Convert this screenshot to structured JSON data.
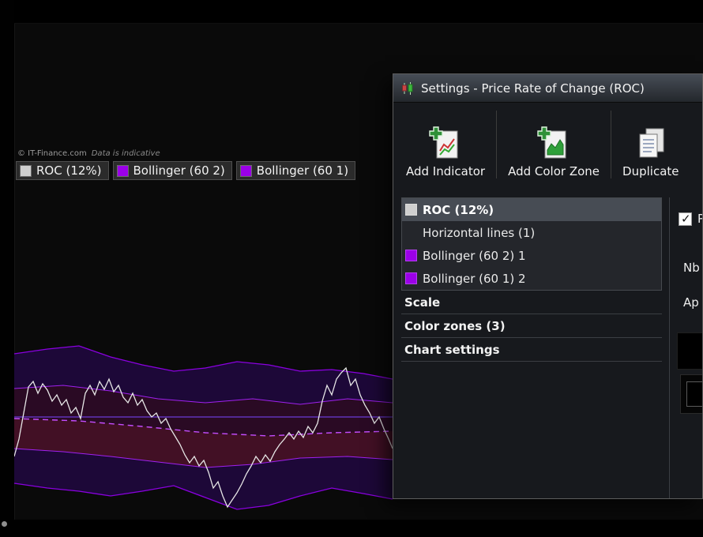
{
  "chart": {
    "watermark_brand": "© IT-Finance.com",
    "watermark_note": "Data is indicative",
    "legend": [
      {
        "label": "ROC (12%)",
        "color": "#cfcfcf"
      },
      {
        "label": "Bollinger (60 2)",
        "color": "#9b00e8"
      },
      {
        "label": "Bollinger (60 1)",
        "color": "#9b00e8"
      }
    ]
  },
  "dialog": {
    "title": "Settings - Price Rate of Change (ROC)",
    "toolbar": {
      "add_indicator": "Add Indicator",
      "add_color_zone": "Add Color Zone",
      "duplicate": "Duplicate"
    },
    "indicators": [
      {
        "label": "ROC (12%)",
        "color": "#cfcfcf"
      },
      {
        "label": "Horizontal lines (1)"
      },
      {
        "label": "Bollinger (60 2) 1",
        "color": "#9b00e8"
      },
      {
        "label": "Bollinger (60 1) 2",
        "color": "#9b00e8"
      }
    ],
    "sections": [
      "Scale",
      "Color zones (3)",
      "Chart settings"
    ],
    "properties": {
      "checkbox_label": "P",
      "label_nb": "Nb",
      "label_ap": "Ap"
    }
  },
  "colors": {
    "accent_purple": "#9b00e8",
    "roc_line": "#e6e6e6",
    "selected_row": "#474c54"
  },
  "chart_series": {
    "outer_top": "0,20 42,14 82,10 122,24 162,34 202,42 242,38 282,30 322,34 362,42 402,40 442,45 479,52",
    "outer_bottom": "0,184 42,190 82,194 122,200 162,194 202,187 242,202 282,217 322,212 362,200 402,190 442,197 479,204",
    "outer_fill": "0,20 42,14 82,10 122,24 162,34 202,42 242,38 282,30 322,34 362,42 402,40 442,45 479,52 479,204 442,197 402,190 362,200 322,212 282,217 242,202 202,187 162,194 122,200 82,194 42,190 0,184",
    "inner_top": "0,64 62,60 122,67 182,77 242,82 302,77 362,84 422,77 479,82",
    "inner_bottom": "0,140 62,144 122,150 182,157 242,164 302,160 362,152 422,150 479,154",
    "inner_fill": "0,64 62,60 122,67 182,77 242,82 302,77 362,84 422,77 479,82 479,154 422,150 362,152 302,160 242,164 182,157 122,150 62,144 0,140",
    "center_dashed": "0,102 82,105 162,112 242,120 322,124 402,120 479,118",
    "red_fill": "0,102 82,105 162,112 242,120 322,124 402,120 479,118 479,154 422,150 362,152 302,160 242,164 182,157 122,150 62,144 0,140",
    "zero_line": "0,100 479,100",
    "roc": "0,150 6,128 12,95 18,62 24,55 30,70 36,58 42,66 48,80 54,72 60,85 66,78 72,95 78,88 84,102 90,70 96,60 102,72 108,55 114,65 120,52 126,68 132,60 138,75 144,82 150,70 156,85 162,78 168,92 174,100 180,95 186,108 192,102 198,115 204,125 210,135 216,148 222,158 228,150 234,162 240,155 246,170 252,190 258,182 264,200 270,214 276,205 282,196 288,185 294,172 300,162 306,150 312,158 318,148 324,156 330,144 336,135 342,128 348,120 354,128 360,118 366,126 372,112 378,120 384,108 390,80 396,60 402,72 408,52 414,44 420,38 426,60 432,52 438,72 444,85 450,95 456,108 462,100 468,115 474,128 479,140"
  }
}
